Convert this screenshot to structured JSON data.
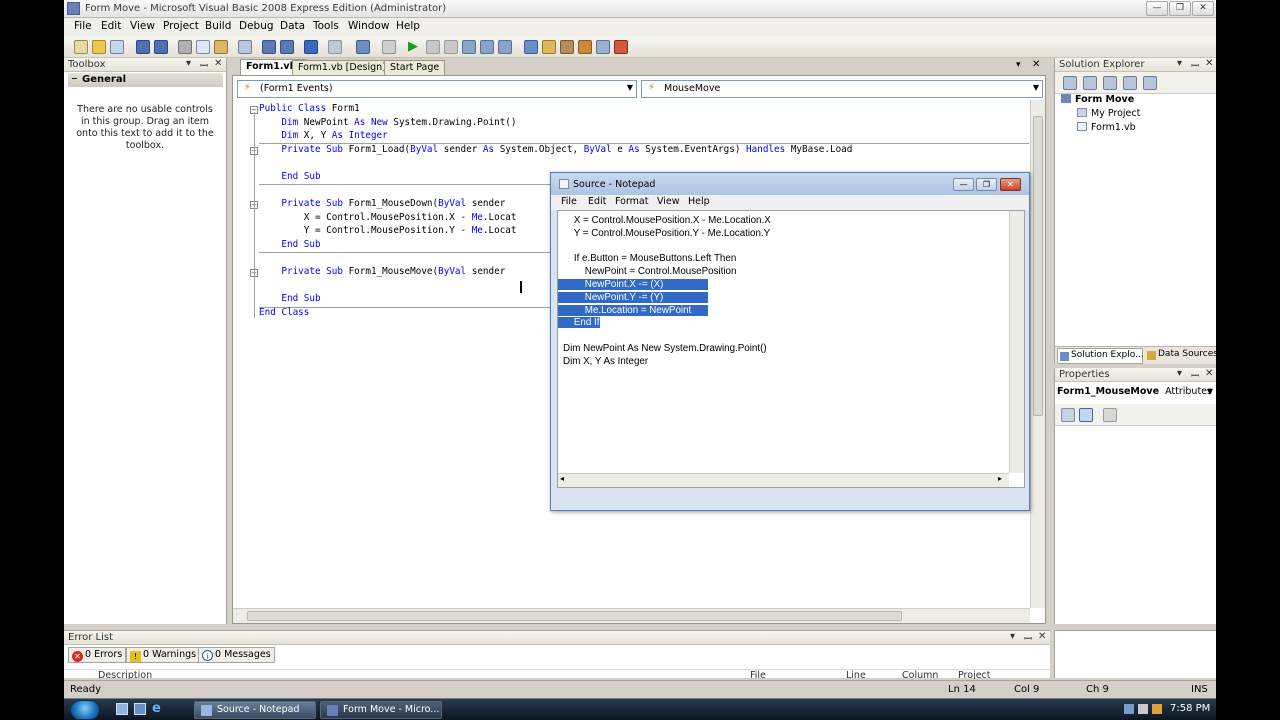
{
  "window": {
    "title": "Form Move - Microsoft Visual Basic 2008 Express Edition (Administrator)"
  },
  "menu": [
    "File",
    "Edit",
    "View",
    "Project",
    "Build",
    "Debug",
    "Data",
    "Tools",
    "Window",
    "Help"
  ],
  "toolbox": {
    "title": "Toolbox",
    "group": "General",
    "message": "There are no usable controls in this group. Drag an item onto this text to add it to the toolbox."
  },
  "editor": {
    "tabs": [
      {
        "label": "Form1.vb*",
        "active": true
      },
      {
        "label": "Form1.vb [Design]*",
        "active": false
      },
      {
        "label": "Start Page",
        "active": false
      }
    ],
    "class_combo": "(Form1 Events)",
    "method_combo": "MouseMove",
    "code": [
      [
        {
          "k": "kw",
          "t": "Public Class "
        },
        {
          "t": "Form1"
        }
      ],
      [
        {
          "t": "    "
        },
        {
          "k": "kw",
          "t": "Dim "
        },
        {
          "t": "NewPoint "
        },
        {
          "k": "kw",
          "t": "As New "
        },
        {
          "t": "System.Drawing.Point()"
        }
      ],
      [
        {
          "t": "    "
        },
        {
          "k": "kw",
          "t": "Dim "
        },
        {
          "t": "X, Y "
        },
        {
          "k": "kw",
          "t": "As Integer"
        }
      ],
      [
        {
          "t": "    "
        },
        {
          "k": "kw",
          "t": "Private Sub "
        },
        {
          "t": "Form1_Load("
        },
        {
          "k": "kw",
          "t": "ByVal "
        },
        {
          "t": "sender "
        },
        {
          "k": "kw",
          "t": "As "
        },
        {
          "t": "System.Object, "
        },
        {
          "k": "kw",
          "t": "ByVal "
        },
        {
          "t": "e "
        },
        {
          "k": "kw",
          "t": "As "
        },
        {
          "t": "System.EventArgs) "
        },
        {
          "k": "kw",
          "t": "Handles "
        },
        {
          "t": "MyBase.Load"
        }
      ],
      [
        {
          "t": ""
        }
      ],
      [
        {
          "t": "    "
        },
        {
          "k": "kw",
          "t": "End Sub"
        }
      ],
      [
        {
          "t": ""
        }
      ],
      [
        {
          "t": "    "
        },
        {
          "k": "kw",
          "t": "Private Sub "
        },
        {
          "t": "Form1_MouseDown("
        },
        {
          "k": "kw",
          "t": "ByVal "
        },
        {
          "t": "sender "
        }
      ],
      [
        {
          "t": "        X = Control.MousePosition.X - "
        },
        {
          "k": "kw",
          "t": "Me"
        },
        {
          "t": ".Locat"
        }
      ],
      [
        {
          "t": "        Y = Control.MousePosition.Y - "
        },
        {
          "k": "kw",
          "t": "Me"
        },
        {
          "t": ".Locat"
        }
      ],
      [
        {
          "t": "    "
        },
        {
          "k": "kw",
          "t": "End Sub"
        }
      ],
      [
        {
          "t": ""
        }
      ],
      [
        {
          "t": "    "
        },
        {
          "k": "kw",
          "t": "Private Sub "
        },
        {
          "t": "Form1_MouseMove("
        },
        {
          "k": "kw",
          "t": "ByVal "
        },
        {
          "t": "sender "
        }
      ],
      [
        {
          "t": ""
        }
      ],
      [
        {
          "t": "    "
        },
        {
          "k": "kw",
          "t": "End Sub"
        }
      ],
      [
        {
          "k": "kw",
          "t": "End Class"
        }
      ]
    ]
  },
  "notepad": {
    "title": "Source - Notepad",
    "menu": [
      "File",
      "Edit",
      "Format",
      "View",
      "Help"
    ],
    "lines": [
      {
        "text": "    X = Control.MousePosition.X - Me.Location.X",
        "sel": false
      },
      {
        "text": "    Y = Control.MousePosition.Y - Me.Location.Y",
        "sel": false
      },
      {
        "text": "",
        "sel": false
      },
      {
        "text": "    If e.Button = MouseButtons.Left Then",
        "sel": false
      },
      {
        "text": "        NewPoint = Control.MousePosition",
        "sel": false
      },
      {
        "text": "        NewPoint.X -= (X)",
        "sel": true
      },
      {
        "text": "        NewPoint.Y -= (Y)",
        "sel": true
      },
      {
        "text": "        Me.Location = NewPoint",
        "sel": true
      },
      {
        "text": "    End If",
        "sel": true
      },
      {
        "text": "",
        "sel": false
      },
      {
        "text": "Dim NewPoint As New System.Drawing.Point()",
        "sel": false
      },
      {
        "text": "Dim X, Y As Integer",
        "sel": false
      }
    ]
  },
  "solution_explorer": {
    "title": "Solution Explorer",
    "project": "Form Move",
    "items": [
      "My Project",
      "Form1.vb"
    ],
    "tabs": [
      "Solution Explo...",
      "Data Sources"
    ]
  },
  "properties": {
    "title": "Properties",
    "object": "Form1_MouseMove",
    "object_type": "Attributes"
  },
  "error_list": {
    "title": "Error List",
    "errors": "0 Errors",
    "warnings": "0 Warnings",
    "messages": "0 Messages",
    "columns": [
      "Description",
      "File",
      "Line",
      "Column",
      "Project"
    ]
  },
  "status": {
    "state": "Ready",
    "ln": "Ln 14",
    "col": "Col 9",
    "ch": "Ch 9",
    "mode": "INS"
  },
  "taskbar": {
    "items": [
      "Source - Notepad",
      "Form Move - Micro..."
    ],
    "clock": "7:58 PM"
  }
}
